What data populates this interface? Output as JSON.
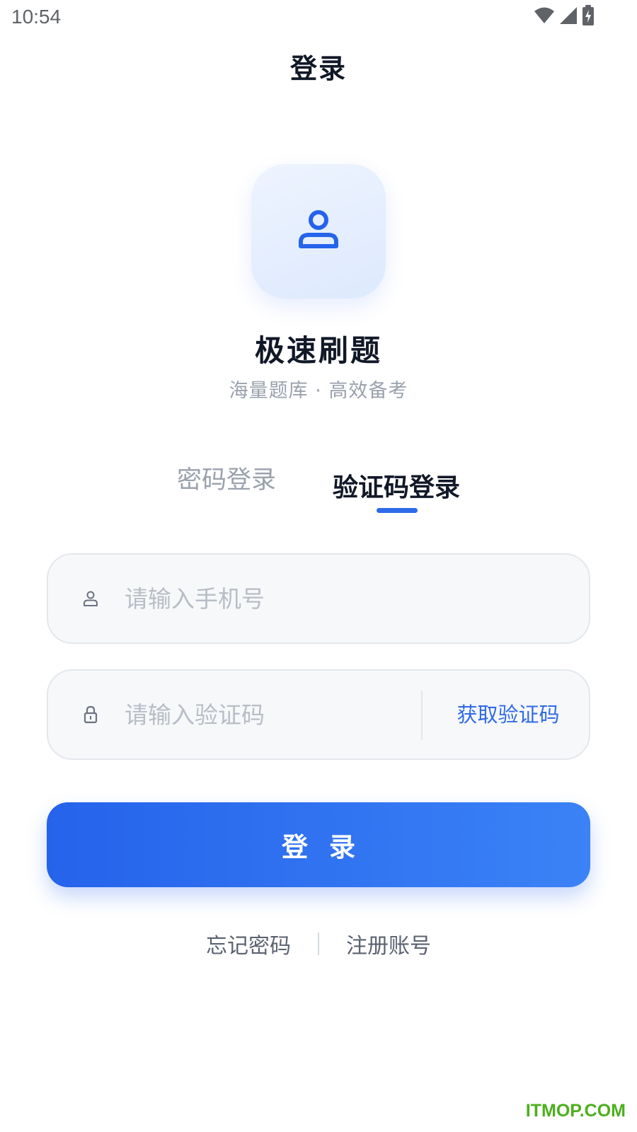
{
  "status_bar": {
    "time": "10:54",
    "icons": [
      "wifi-icon",
      "signal-icon",
      "battery-charging-icon"
    ]
  },
  "header": {
    "title": "登录"
  },
  "app": {
    "logo_icon": "user-icon",
    "name": "极速刷题",
    "slogan": "海量题库 · 高效备考"
  },
  "tabs": [
    {
      "label": "密码登录",
      "active": false
    },
    {
      "label": "验证码登录",
      "active": true
    }
  ],
  "form": {
    "phone": {
      "placeholder": "请输入手机号",
      "value": "",
      "icon": "user-icon"
    },
    "code": {
      "placeholder": "请输入验证码",
      "value": "",
      "icon": "lock-icon"
    },
    "get_code_label": "获取验证码",
    "submit_label": "登录"
  },
  "links": {
    "forgot_password": "忘记密码",
    "register": "注册账号"
  },
  "watermark": "ITMOP.COM",
  "colors": {
    "accent": "#2f6ae8",
    "text_primary": "#111827",
    "text_muted": "#9aa1ad",
    "field_bg": "#f7f8fa"
  }
}
